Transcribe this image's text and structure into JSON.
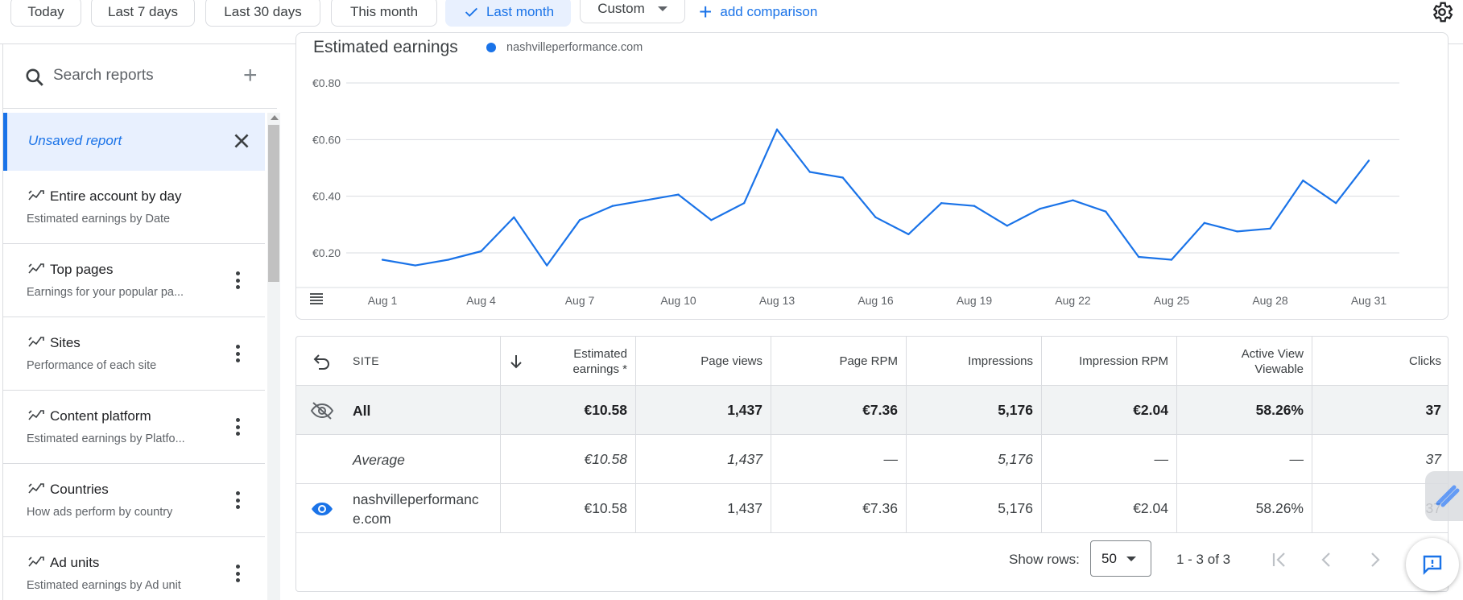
{
  "filters": {
    "chips": [
      "Today",
      "Last 7 days",
      "Last 30 days",
      "This month",
      "Last month",
      "Custom"
    ],
    "selected": "Last month",
    "add_comparison": "add comparison"
  },
  "sidebar": {
    "search_placeholder": "Search reports",
    "unsaved_report": "Unsaved report",
    "reports": [
      {
        "title": "Entire account by day",
        "subtitle": "Estimated earnings by Date"
      },
      {
        "title": "Top pages",
        "subtitle": "Earnings for your popular pa..."
      },
      {
        "title": "Sites",
        "subtitle": "Performance of each site"
      },
      {
        "title": "Content platform",
        "subtitle": "Estimated earnings by Platfo..."
      },
      {
        "title": "Countries",
        "subtitle": "How ads perform by country"
      },
      {
        "title": "Ad units",
        "subtitle": "Estimated earnings by Ad unit"
      }
    ]
  },
  "chart": {
    "title": "Estimated earnings",
    "legend": "nashvilleperformance.com"
  },
  "chart_data": {
    "type": "line",
    "title": "Estimated earnings",
    "xlabel": "",
    "ylabel": "",
    "y_ticks": [
      "€0.80",
      "€0.60",
      "€0.40",
      "€0.20"
    ],
    "x_ticks": [
      "Aug 1",
      "Aug 4",
      "Aug 7",
      "Aug 10",
      "Aug 13",
      "Aug 16",
      "Aug 19",
      "Aug 22",
      "Aug 25",
      "Aug 28",
      "Aug 31"
    ],
    "ylim": [
      0.2,
      0.8
    ],
    "grid": true,
    "series": [
      {
        "name": "nashvilleperformance.com",
        "color": "#1a73e8",
        "x": [
          "Aug 1",
          "Aug 2",
          "Aug 3",
          "Aug 4",
          "Aug 5",
          "Aug 6",
          "Aug 7",
          "Aug 8",
          "Aug 9",
          "Aug 10",
          "Aug 11",
          "Aug 12",
          "Aug 13",
          "Aug 14",
          "Aug 15",
          "Aug 16",
          "Aug 17",
          "Aug 18",
          "Aug 19",
          "Aug 20",
          "Aug 21",
          "Aug 22",
          "Aug 23",
          "Aug 24",
          "Aug 25",
          "Aug 26",
          "Aug 27",
          "Aug 28",
          "Aug 29",
          "Aug 30",
          "Aug 31"
        ],
        "values": [
          0.19,
          0.17,
          0.19,
          0.22,
          0.34,
          0.17,
          0.33,
          0.38,
          0.4,
          0.42,
          0.33,
          0.39,
          0.65,
          0.5,
          0.48,
          0.34,
          0.28,
          0.39,
          0.38,
          0.31,
          0.37,
          0.4,
          0.36,
          0.2,
          0.19,
          0.32,
          0.29,
          0.3,
          0.47,
          0.39,
          0.54
        ]
      }
    ]
  },
  "table": {
    "columns": [
      "SITE",
      "Estimated earnings *",
      "Page views",
      "Page RPM",
      "Impressions",
      "Impression RPM",
      "Active View Viewable",
      "Clicks"
    ],
    "rows": [
      {
        "site": "All",
        "values": [
          "€10.58",
          "1,437",
          "€7.36",
          "5,176",
          "€2.04",
          "58.26%",
          "37"
        ]
      },
      {
        "site": "Average",
        "values": [
          "€10.58",
          "1,437",
          "—",
          "5,176",
          "—",
          "—",
          "37"
        ]
      },
      {
        "site": "nashvilleperformance.com",
        "values": [
          "€10.58",
          "1,437",
          "€7.36",
          "5,176",
          "€2.04",
          "58.26%",
          "37"
        ]
      }
    ],
    "show_rows_label": "Show rows:",
    "rows_per_page": "50",
    "range": "1 - 3 of 3"
  }
}
